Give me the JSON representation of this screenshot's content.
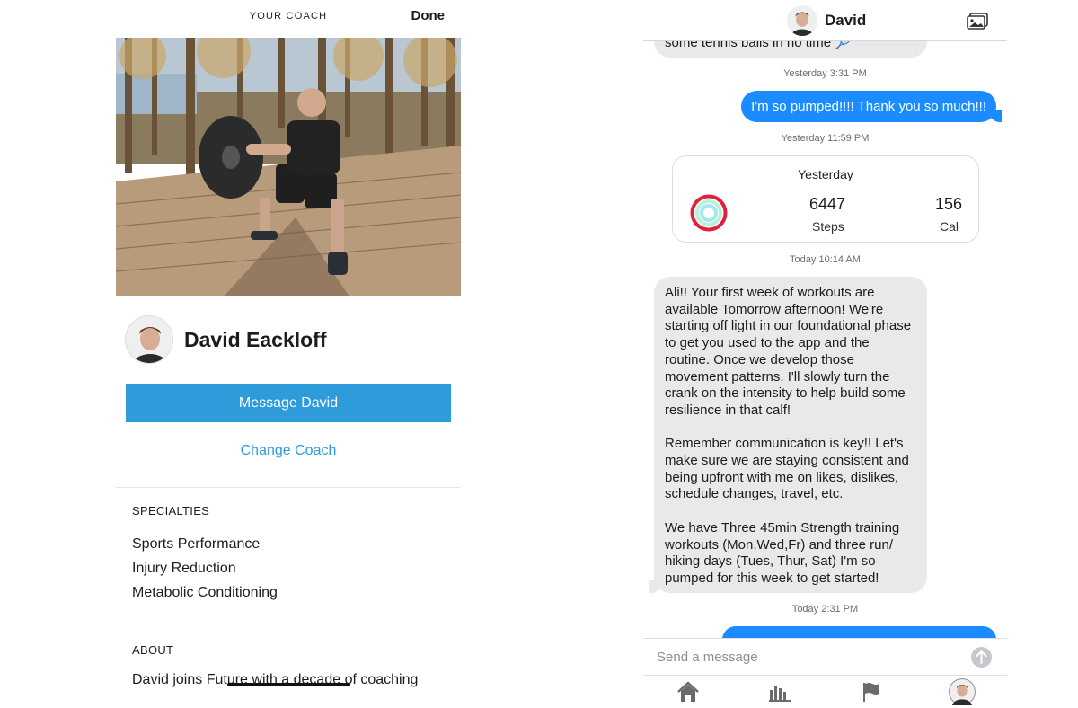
{
  "coach_profile": {
    "header_title": "YOUR COACH",
    "done_label": "Done",
    "coach_name": "David Eackloff",
    "message_button": "Message David",
    "change_coach_link": "Change Coach",
    "specialties_title": "SPECIALTIES",
    "specialties": [
      "Sports Performance",
      "Injury Reduction",
      "Metabolic Conditioning"
    ],
    "about_title": "ABOUT",
    "about_text": "David joins Future with a decade of coaching"
  },
  "chat": {
    "contact_name": "David",
    "messages": {
      "top_partial_text": "some tennis balls in no time 🎾",
      "stamp_1": "Yesterday 3:31 PM",
      "outgoing_1": "I'm so pumped!!!! Thank you so much!!!",
      "stamp_2": "Yesterday 11:59 PM",
      "stamp_3": "Today 10:14 AM",
      "incoming_long": {
        "p1": "Ali!! Your first week of workouts are available Tomorrow afternoon! We're starting off light in our foundational phase to get you used to the app and the routine. Once we develop those movement patterns, I'll slowly turn the crank on the intensity to help build some resilience in that calf!",
        "p2": "Remember communication is key!! Let's make sure we are staying consistent and being upfront with me on likes, dislikes, schedule changes, travel, etc.",
        "p3": "We have Three 45min Strength training workouts (Mon,Wed,Fr) and three run/ hiking days (Tues, Thur, Sat)  I'm so pumped for this week to get started!"
      },
      "stamp_4": "Today 2:31 PM"
    },
    "activity_card": {
      "title": "Yesterday",
      "steps_value": "6447",
      "steps_label": "Steps",
      "cal_value": "156",
      "cal_label": "Cal"
    },
    "composer_placeholder": "Send a message",
    "tabs": [
      "home-icon",
      "stats-icon",
      "flag-icon",
      "profile-icon"
    ]
  },
  "colors": {
    "accent_blue": "#2e9bdb",
    "imessage_blue": "#1a8cff",
    "incoming_gray": "#e9e9eb",
    "ring_red": "#e0203f"
  }
}
